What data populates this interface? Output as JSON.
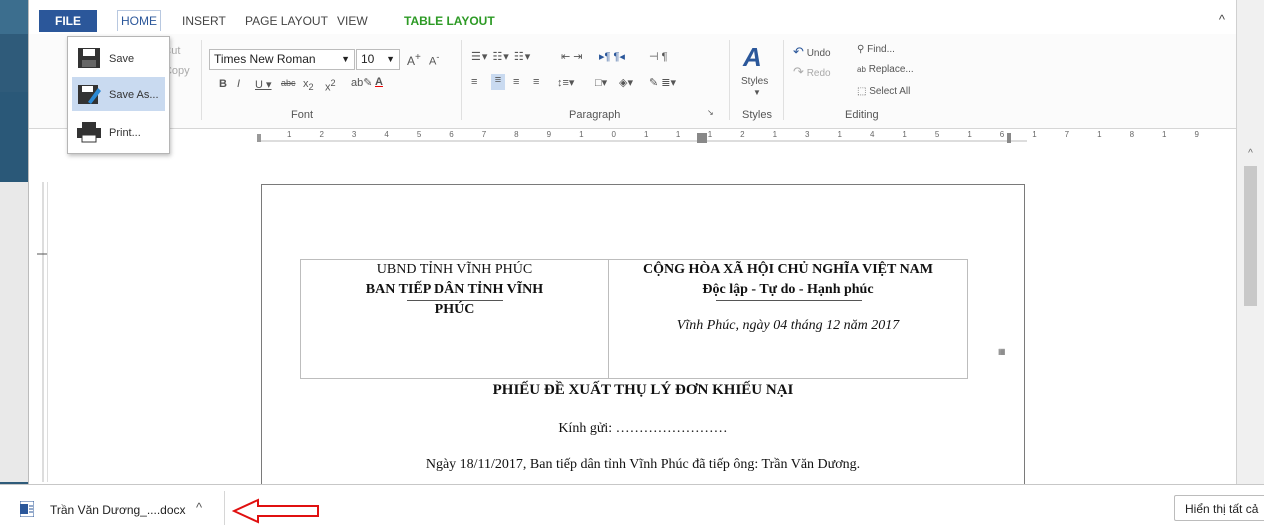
{
  "menu": {
    "tabs": [
      "FILE",
      "HOME",
      "INSERT",
      "PAGE LAYOUT",
      "VIEW",
      "TABLE LAYOUT"
    ]
  },
  "file_menu": {
    "items": [
      "Save",
      "Save As...",
      "Print..."
    ]
  },
  "ribbon": {
    "clipboard": {
      "cut": "Cut",
      "copy": "Copy"
    },
    "font": {
      "name": "Times New Roman",
      "size": "10",
      "group_label": "Font"
    },
    "paragraph": {
      "group_label": "Paragraph"
    },
    "styles": {
      "button": "Styles",
      "group_label": "Styles"
    },
    "editing": {
      "undo": "Undo",
      "redo": "Redo",
      "find": "Find...",
      "replace": "Replace...",
      "select_all": "Select All",
      "group_label": "Editing"
    }
  },
  "ruler": {
    "numbers": [
      "1",
      "1",
      "2",
      "3",
      "4",
      "5",
      "6",
      "7",
      "8",
      "9",
      "10",
      "11",
      "12",
      "13",
      "14",
      "15",
      "16",
      "17",
      "18",
      "19"
    ]
  },
  "document": {
    "left_header": {
      "line1": "UBND TỈNH VĨNH PHÚC",
      "line2": "BAN TIẾP DÂN TỈNH VĨNH",
      "line3": "PHÚC"
    },
    "right_header": {
      "line1": "CỘNG HÒA XÃ HỘI CHỦ NGHĨA VIỆT NAM",
      "line2": "Độc lập - Tự do - Hạnh phúc",
      "place_date": "Vĩnh Phúc, ngày 04 tháng 12 năm 2017"
    },
    "title": "PHIẾU ĐỀ XUẤT THỤ LÝ ĐƠN KHIẾU NẠI",
    "greeting": "Kính gửi: ……………………",
    "body_line1": "Ngày 18/11/2017, Ban tiếp dân tỉnh Vĩnh Phúc đã tiếp ông: Trần Văn Dương."
  },
  "download_bar": {
    "file_name": "Trần Văn Dương_....docx",
    "show_all": "Hiển thị tất cả"
  },
  "colors": {
    "file_tab": "#2b579a",
    "table_layout": "#2d9a25",
    "arrow": "#e01010"
  }
}
